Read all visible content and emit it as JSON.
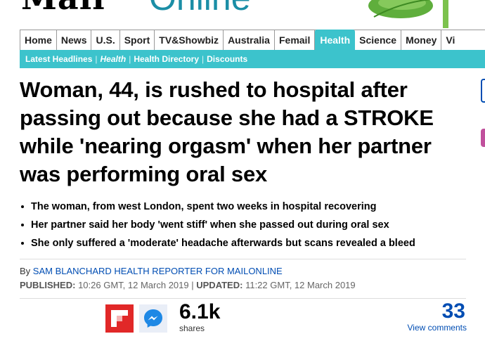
{
  "brand": {
    "logo_main": "Mail",
    "logo_suffix": "Online"
  },
  "nav": {
    "items": [
      {
        "label": "Home"
      },
      {
        "label": "News"
      },
      {
        "label": "U.S."
      },
      {
        "label": "Sport"
      },
      {
        "label": "TV&Showbiz"
      },
      {
        "label": "Australia"
      },
      {
        "label": "Femail"
      },
      {
        "label": "Health",
        "active": true
      },
      {
        "label": "Science"
      },
      {
        "label": "Money"
      },
      {
        "label": "Vi"
      }
    ]
  },
  "subnav": {
    "items": [
      {
        "label": "Latest Headlines"
      },
      {
        "label": "Health"
      },
      {
        "label": "Health Directory"
      },
      {
        "label": "Discounts"
      }
    ]
  },
  "article": {
    "headline": "Woman, 44, is rushed to hospital after passing out because she had a STROKE while 'nearing orgasm' when her partner was performing oral sex",
    "bullets": [
      "The woman, from west London, spent two weeks in hospital recovering",
      "Her partner said her body 'went stiff' when she passed out during oral sex",
      "She only suffered a 'moderate' headache afterwards but scans revealed a bleed"
    ],
    "byline_prefix": "By",
    "author": "SAM BLANCHARD HEALTH REPORTER FOR MAILONLINE",
    "published_label": "PUBLISHED:",
    "published_value": "10:26 GMT, 12 March 2019",
    "separator": "|",
    "updated_label": "UPDATED:",
    "updated_value": "11:22 GMT, 12 March 2019"
  },
  "share": {
    "count": "6.1k",
    "count_label": "shares",
    "comments_count": "33",
    "comments_label": "View comments"
  },
  "colors": {
    "accent": "#3cc3cc",
    "link": "#004db3",
    "flipboard": "#e12828",
    "messenger": "#1e88e5"
  }
}
